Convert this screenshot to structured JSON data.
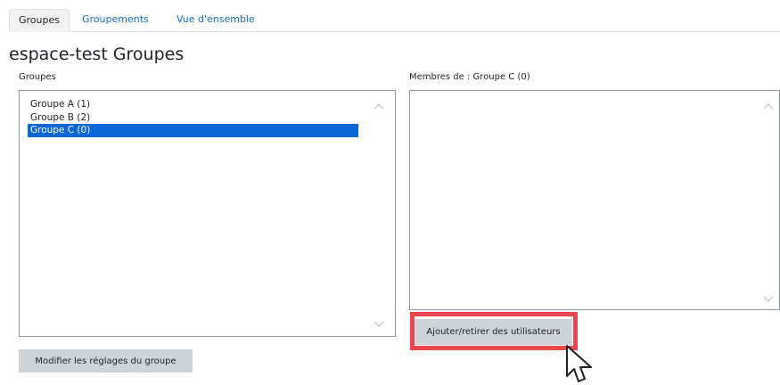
{
  "tabs": [
    {
      "label": "Groupes",
      "active": true
    },
    {
      "label": "Groupements",
      "active": false
    },
    {
      "label": "Vue d'ensemble",
      "active": false
    }
  ],
  "page": {
    "title": "espace-test Groupes"
  },
  "groups_panel": {
    "label": "Groupes",
    "items": [
      {
        "label": "Groupe A (1)",
        "selected": false
      },
      {
        "label": "Groupe B (2)",
        "selected": false
      },
      {
        "label": "Groupe C (0)",
        "selected": true
      }
    ],
    "edit_button": "Modifier les réglages du groupe"
  },
  "members_panel": {
    "label": "Membres de : Groupe C (0)",
    "members": [],
    "add_remove_button": "Ajouter/retirer des utilisateurs"
  },
  "colors": {
    "link": "#0f6cbf",
    "selection": "#0a66d4",
    "button_bg": "#ced4da",
    "highlight_border": "#e8474b"
  },
  "icons": [
    "chevron-up-icon",
    "chevron-down-icon",
    "mouse-pointer-icon"
  ]
}
